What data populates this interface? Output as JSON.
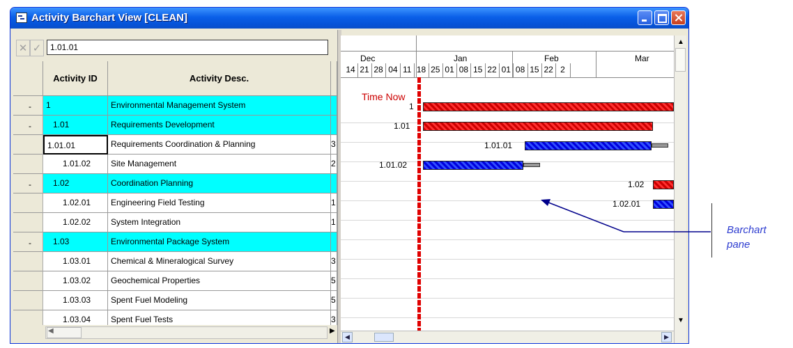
{
  "window": {
    "title": "Activity Barchart View [CLEAN]"
  },
  "edit_bar": {
    "cancel_symbol": "✕",
    "accept_symbol": "✓",
    "value": "1.01.01"
  },
  "grid": {
    "headers": {
      "id": "Activity ID",
      "desc": "Activity Desc."
    },
    "rows": [
      {
        "toggle": "-",
        "id": "1",
        "desc": "Environmental Management System",
        "extra": ""
      },
      {
        "toggle": "-",
        "id": "1.01",
        "desc": "Requirements Development",
        "extra": ""
      },
      {
        "toggle": "",
        "id": "1.01.01",
        "desc": "Requirements Coordination & Planning",
        "extra": "3"
      },
      {
        "toggle": "",
        "id": "1.01.02",
        "desc": "Site Management",
        "extra": "2"
      },
      {
        "toggle": "-",
        "id": "1.02",
        "desc": "Coordination Planning",
        "extra": ""
      },
      {
        "toggle": "",
        "id": "1.02.01",
        "desc": "Engineering Field Testing",
        "extra": "1"
      },
      {
        "toggle": "",
        "id": "1.02.02",
        "desc": "System Integration",
        "extra": "1"
      },
      {
        "toggle": "-",
        "id": "1.03",
        "desc": "Environmental Package System",
        "extra": ""
      },
      {
        "toggle": "",
        "id": "1.03.01",
        "desc": "Chemical & Mineralogical Survey",
        "extra": "3"
      },
      {
        "toggle": "",
        "id": "1.03.02",
        "desc": "Geochemical Properties",
        "extra": "5"
      },
      {
        "toggle": "",
        "id": "1.03.03",
        "desc": "Spent Fuel Modeling",
        "extra": "5"
      },
      {
        "toggle": "",
        "id": "1.03.04",
        "desc": "Spent Fuel Tests",
        "extra": "3"
      }
    ]
  },
  "timescale": {
    "months": [
      "Dec",
      "Jan",
      "Feb",
      "Mar"
    ],
    "days": [
      "14",
      "21",
      "28",
      "04",
      "11",
      "18",
      "25",
      "01",
      "08",
      "15",
      "22",
      "01",
      "08",
      "15",
      "22",
      "2"
    ]
  },
  "bars": [
    {
      "label": "1",
      "color": "red"
    },
    {
      "label": "1.01",
      "color": "red"
    },
    {
      "label": "1.01.01",
      "color": "blue"
    },
    {
      "label": "1.01.02",
      "color": "blue"
    },
    {
      "label": "1.02",
      "color": "red"
    },
    {
      "label": "1.02.01",
      "color": "blue"
    }
  ],
  "time_now": "Time Now",
  "annotation": {
    "line1": "Barchart",
    "line2": "pane"
  },
  "colors": {
    "summary_row": "#00ffff",
    "summary_bar": "#cc0000",
    "detail_bar": "#0000dd",
    "time_now": "#e00000",
    "annotation": "#2d3cd0"
  }
}
